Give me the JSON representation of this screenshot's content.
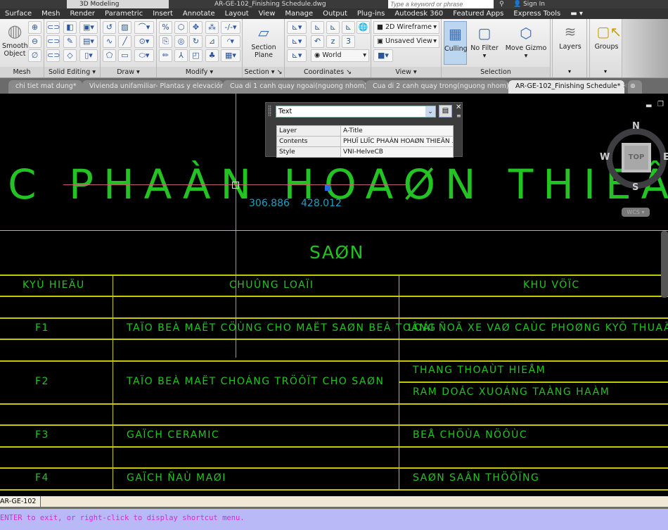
{
  "window": {
    "title": "AR-GE-102_Finishing Schedule.dwg",
    "workspace": "3D Modeling",
    "search_placeholder": "Type a keyword or phrase",
    "sign_in": "Sign In"
  },
  "menu": [
    "Surface",
    "Mesh",
    "Render",
    "Parametric",
    "Insert",
    "Annotate",
    "Layout",
    "View",
    "Manage",
    "Output",
    "Plug-ins",
    "Autodesk 360",
    "Featured Apps",
    "Express Tools"
  ],
  "ribbon": {
    "mesh": {
      "title": "Mesh",
      "big": "Smooth Object"
    },
    "solid_editing": {
      "title": "Solid Editing"
    },
    "draw": {
      "title": "Draw"
    },
    "modify": {
      "title": "Modify"
    },
    "section": {
      "title": "Section",
      "big": "Section Plane"
    },
    "coordinates": {
      "title": "Coordinates",
      "ucs_dropdown": "World"
    },
    "view": {
      "title": "View",
      "visual_style": "2D Wireframe",
      "named_view": "Unsaved View"
    },
    "selection": {
      "title": "Selection",
      "culling": "Culling",
      "no_filter": "No Filter",
      "move_gizmo": "Move Gizmo"
    },
    "layers": {
      "title": "Layers"
    },
    "groups": {
      "title": "Groups"
    }
  },
  "file_tabs": [
    {
      "label": "chi tiet mat dung*",
      "active": false
    },
    {
      "label": "Vivienda unifamiliar- Plantas y elevación*",
      "active": false
    },
    {
      "label": "Cua di 1 canh quay ngoai(nguong nhom)*",
      "active": false
    },
    {
      "label": "Cua di 2 canh quay trong(nguong nhom)*",
      "active": false
    },
    {
      "label": "AR-GE-102_Finishing Schedule*",
      "active": true
    }
  ],
  "quick_properties": {
    "type": "Text",
    "rows": [
      {
        "label": "Layer",
        "value": "A-Title"
      },
      {
        "label": "Contents",
        "value": "PHUÏ LUÏC PHAÀN HOAØN THIEÄN ..."
      },
      {
        "label": "Style",
        "value": "VNI-HelveCB"
      }
    ]
  },
  "drawing": {
    "big_title": "ÏC PHAÀN HOAØN THIEÂN VAÄ",
    "coord_x": "306.886",
    "coord_y": "428.012",
    "section_title": "SAØN",
    "headers": [
      "KYÙ HIEÄU",
      "CHUÛNG LOAÏI",
      "KHU VÖÏC"
    ],
    "rows": [
      {
        "code": "F1",
        "type": "TAÏO BEÀ MAËT CÖÙNG CHO MAËT SAØN BEÂ TOÂNG",
        "areas": [
          "LOÁI ÑOÃ XE VAØ CAÙC PHOØNG KYÕ THUAÄ"
        ]
      },
      {
        "code": "F2",
        "type": "TAÏO BEÀ MAËT CHOÁNG TRÖÔÏT CHO SAØN",
        "areas": [
          "THANG THOAÙT HIEÅM",
          "RAM DOÁC XUOÁNG TAÀNG HAÀM"
        ]
      },
      {
        "code": "F3",
        "type": "GAÏCH CERAMIC",
        "areas": [
          "BEÅ CHÖÙA NÖÔÙC"
        ]
      },
      {
        "code": "F4",
        "type": "GAÏCH ÑAÙ MAØI",
        "areas": [
          "SAØN SAÂN THÖÔÏNG"
        ]
      }
    ]
  },
  "viewcube": {
    "n": "N",
    "s": "S",
    "e": "E",
    "w": "W",
    "face": "TOP",
    "wcs": "WCS"
  },
  "layout_tab": "AR-GE-102",
  "command_line": "ENTER to exit, or right-click to display shortcut menu.",
  "colors": {
    "cad_text": "#22c322",
    "table_lines": "#c8c800",
    "coords": "#1fa0c0",
    "command_bg": "#b9b9f7",
    "command_text": "#d82ad8"
  }
}
